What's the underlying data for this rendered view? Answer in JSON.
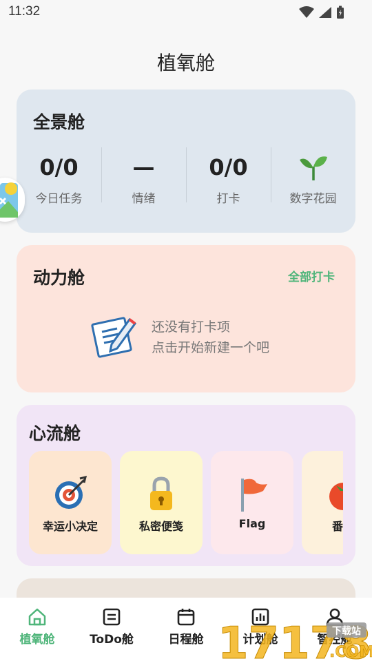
{
  "status_bar": {
    "time": "11:32"
  },
  "page": {
    "title": "植氧舱"
  },
  "overview": {
    "title": "全景舱",
    "stats": [
      {
        "value": "0/0",
        "label": "今日任务"
      },
      {
        "value": "—",
        "label": "情绪"
      },
      {
        "value": "0/0",
        "label": "打卡"
      },
      {
        "value": "",
        "label": "数字花园",
        "icon": "sprout-icon"
      }
    ]
  },
  "power": {
    "title": "动力舱",
    "action": "全部打卡",
    "empty_line1": "还没有打卡项",
    "empty_line2": "点击开始新建一个吧"
  },
  "flow": {
    "title": "心流舱",
    "tiles": [
      {
        "label": "幸运小决定",
        "icon": "target-icon",
        "bg": "#fde6d0"
      },
      {
        "label": "私密便笺",
        "icon": "lock-icon",
        "bg": "#fdf7cf"
      },
      {
        "label": "Flag",
        "icon": "flag-icon",
        "bg": "#fde8ec"
      },
      {
        "label": "番茄",
        "icon": "tomato-icon",
        "bg": "#fdf1dc"
      }
    ]
  },
  "nav": {
    "items": [
      {
        "label": "植氧舱",
        "icon": "home-icon",
        "active": true
      },
      {
        "label": "ToDo舱",
        "icon": "todo-icon",
        "active": false
      },
      {
        "label": "日程舱",
        "icon": "calendar-icon",
        "active": false
      },
      {
        "label": "计划舱",
        "icon": "chart-icon",
        "active": false
      },
      {
        "label": "智控舱",
        "icon": "user-icon",
        "active": false
      }
    ]
  },
  "colors": {
    "accent": "#4fb57a",
    "overview_bg": "#dfe7ef",
    "power_bg": "#fde4dc",
    "flow_bg": "#f1e5f6"
  },
  "watermark": {
    "text": "17178",
    "suffix": ".COM",
    "badge": "下载站"
  }
}
